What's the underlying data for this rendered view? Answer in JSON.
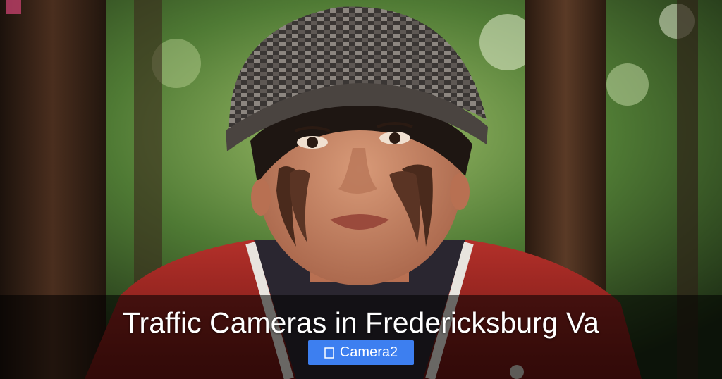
{
  "hero_image": {
    "subject": "boy in knit beanie and red jacket with mud on cheeks in forest"
  },
  "caption": {
    "title": "Traffic Cameras in Fredericksburg Va",
    "tag_label": "Camera2",
    "tag_icon": "folder-icon"
  },
  "colors": {
    "tag_background": "#3d7ff0",
    "caption_overlay": "rgba(0,0,0,0.55)",
    "text": "#ffffff"
  }
}
